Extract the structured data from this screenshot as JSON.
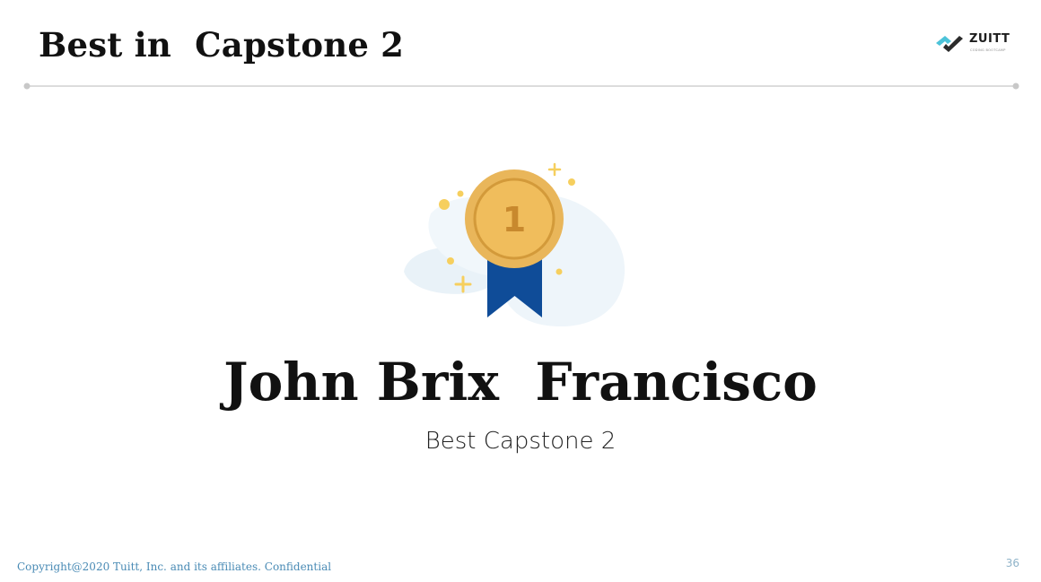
{
  "slide": {
    "title": "Best in  Capstone 2",
    "recipient_name": "John Brix  Francisco",
    "award": "Best Capstone 2",
    "medal_rank": "1"
  },
  "logo": {
    "name": "ZUITT",
    "tagline": "CODING BOOTCAMP",
    "icon": "zuitt-logo-mark"
  },
  "footer": {
    "copyright": "Copyright@2020 Tuitt, Inc. and its affiliates. Confidential",
    "page_number": "36"
  },
  "colors": {
    "medal_gold": "#E9B65A",
    "medal_inner": "#F0BD5C",
    "ribbon_blue": "#0F4C98",
    "logo_teal": "#4CC3D9",
    "footer_text": "#4A8BB5",
    "rule": "#D0D0D0"
  }
}
